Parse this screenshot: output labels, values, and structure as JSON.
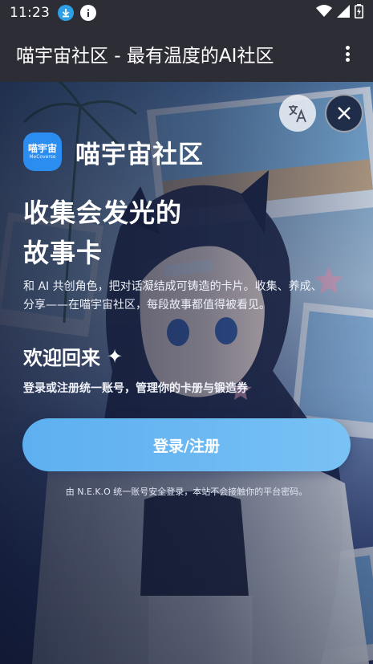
{
  "status_bar": {
    "time": "11:23",
    "icons": [
      "download-icon",
      "info-icon",
      "wifi-icon",
      "signal-icon",
      "battery-icon"
    ]
  },
  "app_bar": {
    "title": "喵宇宙社区 - 最有温度的AI社区",
    "menu_icon": "more-vert-icon"
  },
  "login_card": {
    "translate_icon": "translate-icon",
    "close_icon": "close-icon",
    "logo_text": "喵宇宙",
    "logo_subtext": "MeCoverse",
    "brand_name": "喵宇宙社区",
    "headline_line1": "收集会发光的",
    "headline_line2": "故事卡",
    "description": "和 AI 共创角色，把对话凝结成可铸造的卡片。收集、养成、分享——在喵宇宙社区，每段故事都值得被看见。",
    "welcome_title": "欢迎回来",
    "welcome_sparkle": "✦",
    "welcome_subtitle": "登录或注册统一账号，管理你的卡册与锻造券",
    "login_button": "登录/注册",
    "footnote": "由 N.E.K.O 统一账号安全登录，本站不会接触你的平台密码。"
  },
  "colors": {
    "bar_bg": "#2d2d35",
    "button_start": "#5db0f0",
    "button_end": "#79c2f5",
    "logo_blue": "#2c8df0"
  }
}
